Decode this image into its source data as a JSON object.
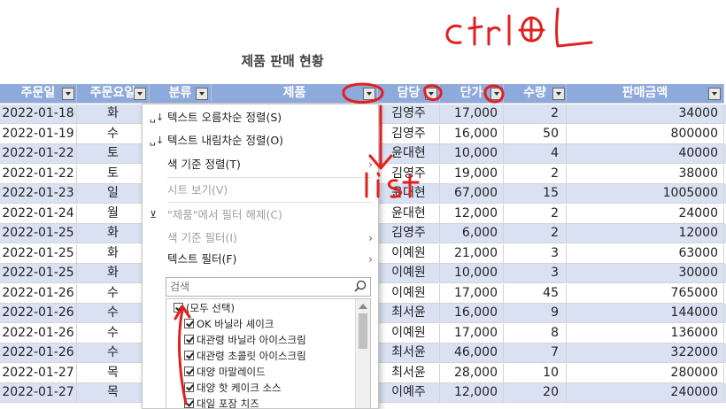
{
  "sheet": {
    "title": "제품 판매 현황",
    "headers": [
      "주문일",
      "주문요일",
      "분류",
      "제품",
      "담당",
      "단가",
      "수량",
      "판매금액"
    ],
    "rows": [
      {
        "date": "2022-01-18",
        "day": "화",
        "rep": "김영주",
        "price": "17,000",
        "qty": "2",
        "amt": "34000"
      },
      {
        "date": "2022-01-19",
        "day": "수",
        "rep": "김영주",
        "price": "16,000",
        "qty": "50",
        "amt": "800000"
      },
      {
        "date": "2022-01-22",
        "day": "토",
        "rep": "윤대현",
        "price": "10,000",
        "qty": "4",
        "amt": "40000"
      },
      {
        "date": "2022-01-22",
        "day": "토",
        "rep": "김영주",
        "price": "19,000",
        "qty": "2",
        "amt": "38000"
      },
      {
        "date": "2022-01-23",
        "day": "일",
        "rep": "윤대현",
        "price": "67,000",
        "qty": "15",
        "amt": "1005000"
      },
      {
        "date": "2022-01-24",
        "day": "월",
        "rep": "윤대현",
        "price": "12,000",
        "qty": "2",
        "amt": "24000"
      },
      {
        "date": "2022-01-25",
        "day": "화",
        "rep": "김영주",
        "price": "6,000",
        "qty": "2",
        "amt": "12000"
      },
      {
        "date": "2022-01-25",
        "day": "화",
        "rep": "이예원",
        "price": "21,000",
        "qty": "3",
        "amt": "63000"
      },
      {
        "date": "2022-01-25",
        "day": "화",
        "rep": "이예원",
        "price": "10,000",
        "qty": "3",
        "amt": "30000"
      },
      {
        "date": "2022-01-26",
        "day": "수",
        "rep": "이예원",
        "price": "17,000",
        "qty": "45",
        "amt": "765000"
      },
      {
        "date": "2022-01-26",
        "day": "수",
        "rep": "최서윤",
        "price": "16,000",
        "qty": "9",
        "amt": "144000"
      },
      {
        "date": "2022-01-26",
        "day": "수",
        "rep": "이예원",
        "price": "17,000",
        "qty": "8",
        "amt": "136000"
      },
      {
        "date": "2022-01-26",
        "day": "수",
        "rep": "최서윤",
        "price": "46,000",
        "qty": "7",
        "amt": "322000"
      },
      {
        "date": "2022-01-27",
        "day": "목",
        "rep": "최서윤",
        "price": "28,000",
        "qty": "10",
        "amt": "280000"
      },
      {
        "date": "2022-01-27",
        "day": "목",
        "rep": "이예주",
        "price": "12,000",
        "qty": "20",
        "amt": "240000"
      }
    ]
  },
  "menu": {
    "sort_asc": "텍스트 오름차순 정렬(S)",
    "sort_desc": "텍스트 내림차순 정렬(O)",
    "sort_color": "색 기준 정렬(T)",
    "sheet_view": "시트 보기(V)",
    "clear_filter": "\"제품\"에서 필터 해제(C)",
    "color_filter": "색 기준 필터(I)",
    "text_filter": "텍스트 필터(F)",
    "search_placeholder": "검색",
    "items": [
      "(모두 선택)",
      "OK 바닐라 셰이크",
      "대관령 바닐라 아이스크림",
      "대관령 초콜릿 아이스크림",
      "대양 마말레이드",
      "대양 핫 케이크 소스",
      "대일 포장 치즈"
    ]
  },
  "annotations": {
    "shortcut": "Ctrl+L",
    "list": "list",
    "color": "#e32020"
  },
  "icons": {
    "sort_asc": "sort-asc-icon",
    "sort_desc": "sort-desc-icon",
    "filter_clear": "filter-clear-icon",
    "search": "search-icon",
    "submenu": "chevron-right-icon"
  }
}
